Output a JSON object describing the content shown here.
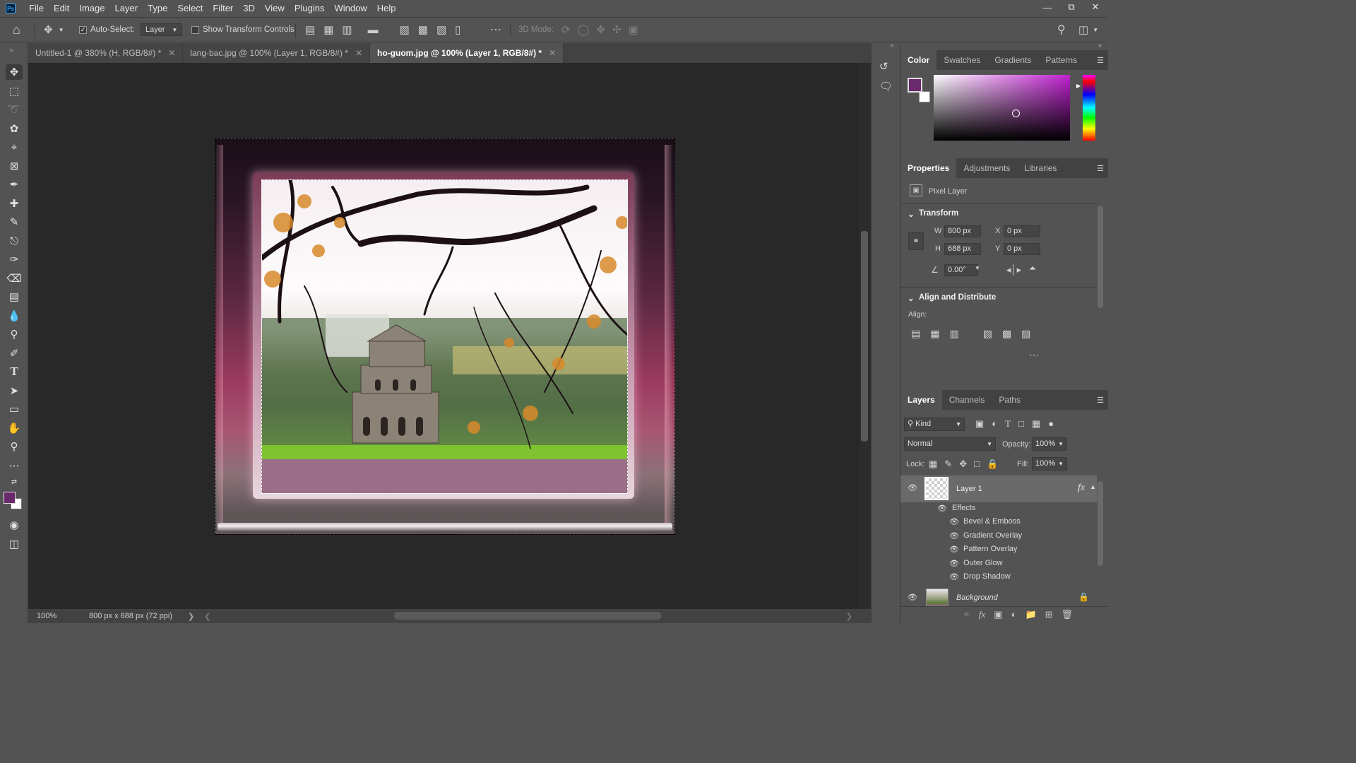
{
  "menubar": {
    "logo": "Ps",
    "items": [
      "File",
      "Edit",
      "Image",
      "Layer",
      "Type",
      "Select",
      "Filter",
      "3D",
      "View",
      "Plugins",
      "Window",
      "Help"
    ]
  },
  "options": {
    "auto_select_label": "Auto-Select:",
    "auto_select_value": "Layer",
    "show_transform_label": "Show Transform Controls",
    "mode_3d_label": "3D Mode:"
  },
  "tabs": [
    {
      "label": "Untitled-1 @ 380% (H, RGB/8#) *"
    },
    {
      "label": "lang-bac.jpg @ 100% (Layer 1, RGB/8#) *"
    },
    {
      "label": "ho-guom.jpg @ 100% (Layer 1, RGB/8#) *"
    }
  ],
  "status": {
    "zoom": "100%",
    "dimensions": "800 px x 688 px (72 ppi)"
  },
  "color_panel": {
    "tabs": [
      "Color",
      "Swatches",
      "Gradients",
      "Patterns"
    ],
    "foreground": "#6b2a6b",
    "background": "#ffffff"
  },
  "properties": {
    "tabs": [
      "Properties",
      "Adjustments",
      "Libraries"
    ],
    "layer_type": "Pixel Layer",
    "transform_title": "Transform",
    "w_label": "W",
    "w_value": "800 px",
    "h_label": "H",
    "h_value": "688 px",
    "x_label": "X",
    "x_value": "0 px",
    "y_label": "Y",
    "y_value": "0 px",
    "angle_value": "0.00°",
    "align_title": "Align and Distribute",
    "align_label": "Align:"
  },
  "layers_panel": {
    "tabs": [
      "Layers",
      "Channels",
      "Paths"
    ],
    "filter_kind": "Kind",
    "blend_mode": "Normal",
    "opacity_label": "Opacity:",
    "opacity_value": "100%",
    "lock_label": "Lock:",
    "fill_label": "Fill:",
    "fill_value": "100%",
    "layers": [
      {
        "name": "Layer 1"
      },
      {
        "name": "Background"
      }
    ],
    "effects_label": "Effects",
    "effects": [
      "Bevel & Emboss",
      "Gradient Overlay",
      "Pattern Overlay",
      "Outer Glow",
      "Drop Shadow"
    ],
    "fx_label": "fx"
  }
}
